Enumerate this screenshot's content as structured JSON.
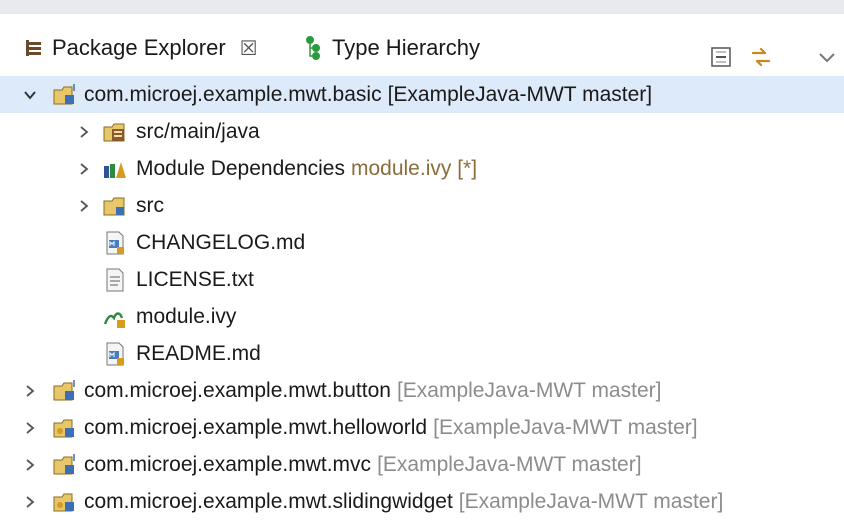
{
  "tabs": [
    {
      "label": "Package Explorer",
      "close_glyph": "☒",
      "icon": "package-explorer-icon"
    },
    {
      "label": "Type Hierarchy",
      "icon": "type-hierarchy-icon"
    }
  ],
  "toolbar": [
    {
      "icon": "collapse-all-icon"
    },
    {
      "icon": "link-with-editor-icon"
    },
    {
      "icon": "view-menu-icon"
    }
  ],
  "tree": {
    "root": {
      "name": "com.microej.example.mwt.basic",
      "decoration": "[ExampleJava-MWT master]",
      "expanded": true,
      "selected": true,
      "children": [
        {
          "name": "src/main/java",
          "icon": "source-folder-icon",
          "expandable": true
        },
        {
          "name": "Module Dependencies",
          "decoration": "module.ivy [*]",
          "icon": "library-icon",
          "expandable": true
        },
        {
          "name": "src",
          "icon": "folder-icon",
          "expandable": true
        },
        {
          "name": "CHANGELOG.md",
          "icon": "markdown-file-icon",
          "expandable": false
        },
        {
          "name": "LICENSE.txt",
          "icon": "text-file-icon",
          "expandable": false
        },
        {
          "name": "module.ivy",
          "icon": "ivy-file-icon",
          "expandable": false
        },
        {
          "name": "README.md",
          "icon": "markdown-file-icon",
          "expandable": false
        }
      ]
    },
    "projects": [
      {
        "name": "com.microej.example.mwt.button",
        "decoration": "[ExampleJava-MWT master]"
      },
      {
        "name": "com.microej.example.mwt.helloworld",
        "decoration": "[ExampleJava-MWT master]"
      },
      {
        "name": "com.microej.example.mwt.mvc",
        "decoration": "[ExampleJava-MWT master]"
      },
      {
        "name": "com.microej.example.mwt.slidingwidget",
        "decoration": "[ExampleJava-MWT master]"
      }
    ]
  },
  "colors": {
    "selection": "#dceaf9",
    "decoration": "#8c8c8c",
    "folder": "#e8c66a",
    "project_badge": "#3d6fb6"
  }
}
